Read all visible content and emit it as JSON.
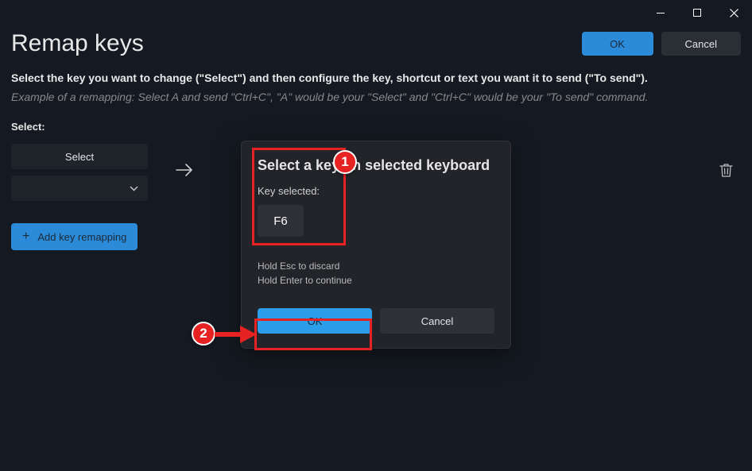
{
  "header": {
    "title": "Remap keys",
    "ok_label": "OK",
    "cancel_label": "Cancel"
  },
  "instructions": {
    "main": "Select the key you want to change (\"Select\") and then configure the key, shortcut or text you want it to send (\"To send\").",
    "example": "Example of a remapping: Select A and send \"Ctrl+C\", \"A\" would be your \"Select\" and \"Ctrl+C\" would be your \"To send\" command."
  },
  "mapping": {
    "select_label": "Select:",
    "select_button": "Select",
    "add_button": "Add key remapping"
  },
  "dialog": {
    "title": "Select a key on selected keyboard",
    "key_selected_label": "Key selected:",
    "selected_key": "F6",
    "hint1": "Hold Esc to discard",
    "hint2": "Hold Enter to continue",
    "ok_label": "OK",
    "cancel_label": "Cancel"
  },
  "annotations": {
    "marker1": "1",
    "marker2": "2"
  }
}
